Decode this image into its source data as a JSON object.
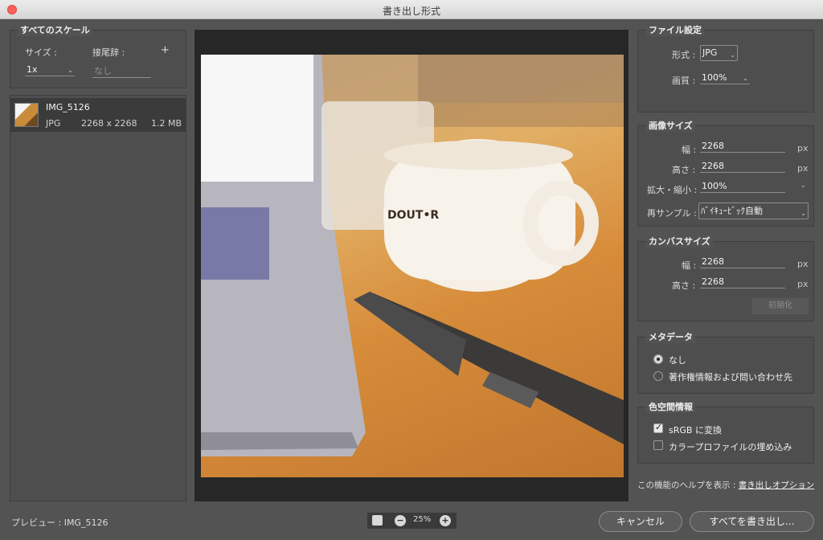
{
  "window": {
    "title": "書き出し形式"
  },
  "scales": {
    "section_title": "すべてのスケール",
    "size_label": "サイズ :",
    "suffix_label": "接尾辞 :",
    "add_symbol": "+",
    "size_value": "1x",
    "suffix_placeholder": "なし"
  },
  "file": {
    "name": "IMG_5126",
    "format": "JPG",
    "dimensions": "2268 x 2268",
    "filesize": "1.2 MB"
  },
  "file_settings": {
    "section_title": "ファイル設定",
    "format_label": "形式 :",
    "format_value": "JPG",
    "quality_label": "画質 :",
    "quality_value": "100%"
  },
  "image_size": {
    "section_title": "画像サイズ",
    "width_label": "幅 :",
    "width_value": "2268",
    "width_unit": "px",
    "height_label": "高さ :",
    "height_value": "2268",
    "height_unit": "px",
    "scale_label": "拡大・縮小 :",
    "scale_value": "100%",
    "resample_label": "再サンプル :",
    "resample_value": "ﾊﾞｲｷｭｰﾋﾞｯｸ自動"
  },
  "canvas_size": {
    "section_title": "カンバスサイズ",
    "width_label": "幅 :",
    "width_value": "2268",
    "width_unit": "px",
    "height_label": "高さ :",
    "height_value": "2268",
    "height_unit": "px",
    "reset_label": "初期化"
  },
  "metadata": {
    "section_title": "メタデータ",
    "option_none": "なし",
    "option_copyright": "著作権情報および問い合わせ先",
    "selected": "none"
  },
  "color_space": {
    "section_title": "色空間情報",
    "srgb_label": "sRGB に変換",
    "srgb_checked": true,
    "profile_label": "カラープロファイルの埋め込み",
    "profile_checked": false
  },
  "help": {
    "prefix": "この機能のヘルプを表示 :",
    "link": "書き出しオプション"
  },
  "footer": {
    "preview_label": "プレビュー : IMG_5126",
    "zoom_value": "25%",
    "cancel_label": "キャンセル",
    "export_label": "すべてを書き出し..."
  },
  "icons": {
    "close": "close-icon",
    "zoom_out": "minus-icon",
    "zoom_in": "plus-icon",
    "fit": "fit-screen-icon"
  },
  "colors": {
    "background": "#535353",
    "panel": "#4e4e4e",
    "preview_bg": "#272727",
    "close_button": "#fc5f57"
  }
}
